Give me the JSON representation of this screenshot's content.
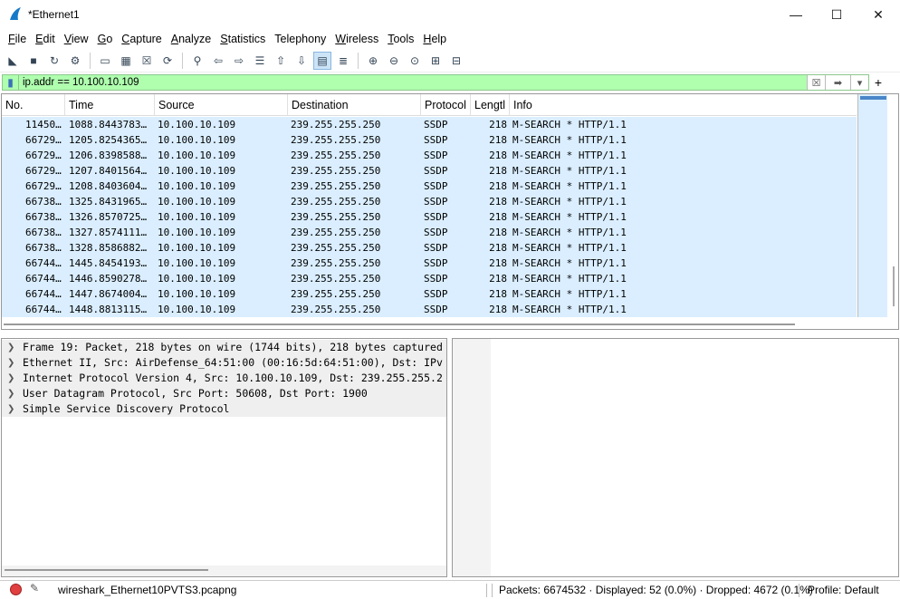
{
  "window": {
    "title": "*Ethernet1",
    "minimize": "—",
    "maximize": "☐",
    "close": "✕"
  },
  "menu": [
    {
      "label": "File",
      "ul": "F",
      "rest": "ile"
    },
    {
      "label": "Edit",
      "ul": "E",
      "rest": "dit"
    },
    {
      "label": "View",
      "ul": "V",
      "rest": "iew"
    },
    {
      "label": "Go",
      "ul": "G",
      "rest": "o"
    },
    {
      "label": "Capture",
      "ul": "C",
      "rest": "apture"
    },
    {
      "label": "Analyze",
      "ul": "A",
      "rest": "nalyze"
    },
    {
      "label": "Statistics",
      "ul": "S",
      "rest": "tatistics"
    },
    {
      "label": "Telephony",
      "ul": "",
      "rest": "Telephony"
    },
    {
      "label": "Wireless",
      "ul": "W",
      "rest": "ireless"
    },
    {
      "label": "Tools",
      "ul": "T",
      "rest": "ools"
    },
    {
      "label": "Help",
      "ul": "H",
      "rest": "elp"
    }
  ],
  "toolbar": {
    "icons": [
      "shark-fin-start-icon",
      "stop-capture-icon",
      "restart-capture-icon",
      "capture-options-icon",
      "open-file-icon",
      "save-file-icon",
      "close-file-icon",
      "reload-file-icon",
      "find-packet-icon",
      "go-back-icon",
      "go-forward-icon",
      "go-to-packet-icon",
      "go-first-icon",
      "go-last-icon",
      "autoscroll-icon",
      "colorize-icon",
      "zoom-in-icon",
      "zoom-out-icon",
      "zoom-normal-icon",
      "resize-columns-icon",
      "layout-icon"
    ]
  },
  "filter": {
    "value": "ip.addr == 10.100.10.109",
    "plus": "+"
  },
  "packet_list": {
    "columns": [
      "No.",
      "Time",
      "Source",
      "Destination",
      "Protocol",
      "Lengtl",
      "Info"
    ],
    "rows": [
      {
        "no": "11450…",
        "time": "1088.8443783…",
        "src": "10.100.10.109",
        "dst": "239.255.255.250",
        "proto": "SSDP",
        "len": "218",
        "info": "M-SEARCH * HTTP/1.1"
      },
      {
        "no": "66729…",
        "time": "1205.8254365…",
        "src": "10.100.10.109",
        "dst": "239.255.255.250",
        "proto": "SSDP",
        "len": "218",
        "info": "M-SEARCH * HTTP/1.1"
      },
      {
        "no": "66729…",
        "time": "1206.8398588…",
        "src": "10.100.10.109",
        "dst": "239.255.255.250",
        "proto": "SSDP",
        "len": "218",
        "info": "M-SEARCH * HTTP/1.1"
      },
      {
        "no": "66729…",
        "time": "1207.8401564…",
        "src": "10.100.10.109",
        "dst": "239.255.255.250",
        "proto": "SSDP",
        "len": "218",
        "info": "M-SEARCH * HTTP/1.1"
      },
      {
        "no": "66729…",
        "time": "1208.8403604…",
        "src": "10.100.10.109",
        "dst": "239.255.255.250",
        "proto": "SSDP",
        "len": "218",
        "info": "M-SEARCH * HTTP/1.1"
      },
      {
        "no": "66738…",
        "time": "1325.8431965…",
        "src": "10.100.10.109",
        "dst": "239.255.255.250",
        "proto": "SSDP",
        "len": "218",
        "info": "M-SEARCH * HTTP/1.1"
      },
      {
        "no": "66738…",
        "time": "1326.8570725…",
        "src": "10.100.10.109",
        "dst": "239.255.255.250",
        "proto": "SSDP",
        "len": "218",
        "info": "M-SEARCH * HTTP/1.1"
      },
      {
        "no": "66738…",
        "time": "1327.8574111…",
        "src": "10.100.10.109",
        "dst": "239.255.255.250",
        "proto": "SSDP",
        "len": "218",
        "info": "M-SEARCH * HTTP/1.1"
      },
      {
        "no": "66738…",
        "time": "1328.8586882…",
        "src": "10.100.10.109",
        "dst": "239.255.255.250",
        "proto": "SSDP",
        "len": "218",
        "info": "M-SEARCH * HTTP/1.1"
      },
      {
        "no": "66744…",
        "time": "1445.8454193…",
        "src": "10.100.10.109",
        "dst": "239.255.255.250",
        "proto": "SSDP",
        "len": "218",
        "info": "M-SEARCH * HTTP/1.1"
      },
      {
        "no": "66744…",
        "time": "1446.8590278…",
        "src": "10.100.10.109",
        "dst": "239.255.255.250",
        "proto": "SSDP",
        "len": "218",
        "info": "M-SEARCH * HTTP/1.1"
      },
      {
        "no": "66744…",
        "time": "1447.8674004…",
        "src": "10.100.10.109",
        "dst": "239.255.255.250",
        "proto": "SSDP",
        "len": "218",
        "info": "M-SEARCH * HTTP/1.1"
      },
      {
        "no": "66744…",
        "time": "1448.8813115…",
        "src": "10.100.10.109",
        "dst": "239.255.255.250",
        "proto": "SSDP",
        "len": "218",
        "info": "M-SEARCH * HTTP/1.1"
      }
    ]
  },
  "details": [
    "Frame 19: Packet, 218 bytes on wire (1744 bits), 218 bytes captured",
    "Ethernet II, Src: AirDefense_64:51:00 (00:16:5d:64:51:00), Dst: IPv",
    "Internet Protocol Version 4, Src: 10.100.10.109, Dst: 239.255.255.2",
    "User Datagram Protocol, Src Port: 50608, Dst Port: 1900",
    "Simple Service Discovery Protocol"
  ],
  "status": {
    "file": "wireshark_Ethernet10PVTS3.pcapng",
    "packets": "Packets: 6674532 · Displayed: 52 (0.0%) · Dropped: 4672 (0.1%)",
    "profile": "Profile: Default"
  },
  "colors": {
    "filter_bg": "#afffaf",
    "row_bg": "#daeeff",
    "detail_bg": "#efefef",
    "accent": "#4a86c8"
  }
}
